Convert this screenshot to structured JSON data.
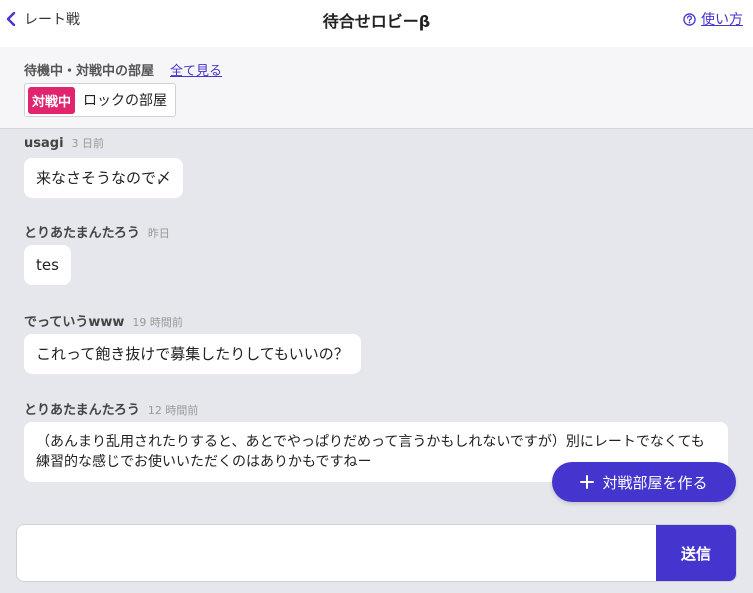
{
  "header": {
    "back_label": "レート戦",
    "title": "待合せロビーβ",
    "help_label": "使い方"
  },
  "rooms": {
    "label": "待機中・対戦中の部屋",
    "see_all": "全て見る",
    "items": [
      {
        "status": "対戦中",
        "name": "ロックの部屋"
      }
    ]
  },
  "messages": [
    {
      "author": "usagi",
      "time": "3 日前",
      "text": "来なさそうなので〆"
    },
    {
      "author": "とりあたまんたろう",
      "time": "昨日",
      "text": "tes"
    },
    {
      "author": "でっていうwww",
      "time": "19 時間前",
      "text": "これって飽き抜けで募集したりしてもいいの？"
    },
    {
      "author": "とりあたまんたろう",
      "time": "12 時間前",
      "text": "（あんまり乱用されたりすると、あとでやっぱりだめって言うかもしれないですが）別にレートでなくても練習的な感じでお使いいただくのはありかもですねー"
    }
  ],
  "create_room_label": "対戦部屋を作る",
  "composer": {
    "value": "",
    "send_label": "送信"
  },
  "colors": {
    "accent": "#4435cf",
    "badge": "#e0246d",
    "background": "#e6e7ec"
  }
}
